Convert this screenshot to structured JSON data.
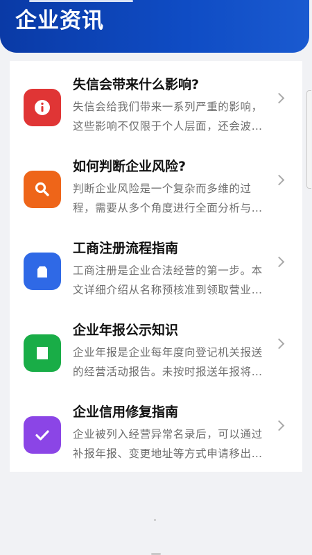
{
  "header": {
    "title": "企业资讯"
  },
  "colors": {
    "header": "#0f47bd",
    "info": "#e03535",
    "risk": "#ee6519",
    "registration": "#2f69e6",
    "annual_report": "#19ad47",
    "credit_repair": "#8b45e6"
  },
  "news": [
    {
      "icon": "info-icon",
      "color": "#e03535",
      "title": "失信会带来什么影响?",
      "desc": "失信会给我们带来一系列严重的影响，这些影响不仅限于个人层面，还会波及企业和社会。"
    },
    {
      "icon": "search-icon",
      "color": "#ee6519",
      "title": "如何判断企业风险?",
      "desc": "判断企业风险是一个复杂而多维的过程，需要从多个角度进行全面分析与评估。"
    },
    {
      "icon": "building-icon",
      "color": "#2f69e6",
      "title": "工商注册流程指南",
      "desc": "工商注册是企业合法经营的第一步。本文详细介绍从名称预核准到领取营业执照的流程。"
    },
    {
      "icon": "document-icon",
      "color": "#19ad47",
      "title": "企业年报公示知识",
      "desc": "企业年报是企业每年度向登记机关报送的经营活动报告。未按时报送年报将被列入经营异常名录。"
    },
    {
      "icon": "check-icon",
      "color": "#8b45e6",
      "title": "企业信用修复指南",
      "desc": "企业被列入经营异常名录后，可以通过补报年报、变更地址等方式申请移出，恢复企业信用。"
    }
  ]
}
